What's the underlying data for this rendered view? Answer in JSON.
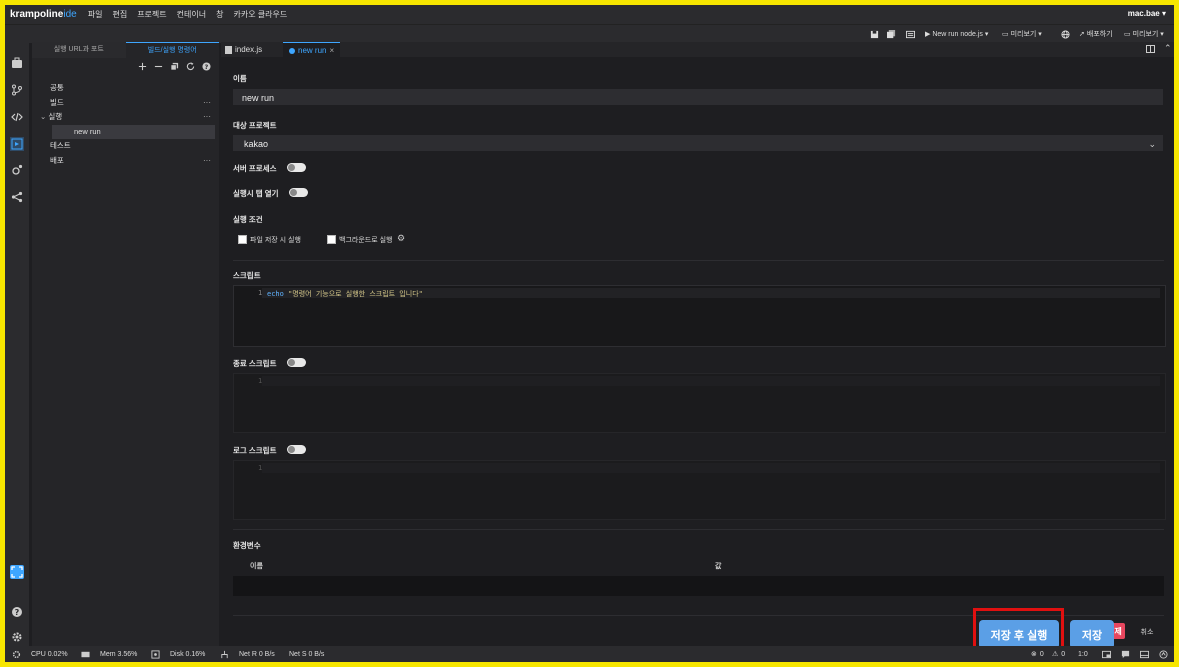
{
  "app": {
    "logo_main": "krampoline",
    "logo_sub": "ide",
    "user": "mac.bae ▾"
  },
  "menu": [
    "파일",
    "편집",
    "프로젝트",
    "컨테이너",
    "창",
    "카카오 클라우드"
  ],
  "toolbar": {
    "run_config": "New run node.js",
    "deploy": "배포하기",
    "preview": "미리보기",
    "preview2": "미리보기"
  },
  "sidebar": {
    "tabs": [
      "실행 URL과 포트",
      "빌드/실행 명령어"
    ],
    "tree": [
      {
        "label": "공통"
      },
      {
        "label": "빌드"
      },
      {
        "label": "실행"
      },
      {
        "label": "new run"
      },
      {
        "label": "테스트"
      },
      {
        "label": "배포"
      }
    ],
    "more": "···"
  },
  "editor": {
    "tabs": [
      {
        "label": "index.js"
      },
      {
        "label": "new run"
      }
    ],
    "name_label": "이름",
    "name_value": "new run",
    "project_label": "대상 프로젝트",
    "project_value": "kakao",
    "server_process_label": "서버 프로세스",
    "open_tab_label": "실행시 탭 열기",
    "run_condition_label": "실행 조건",
    "on_save_label": "파일 저장 시 실행",
    "background_label": "백그라운드로 실행",
    "script_label": "스크립트",
    "script_line_no": "1",
    "script_keyword": "echo",
    "script_string": "\"명령어 기능으로 실행한 스크립트 입니다\"",
    "end_script_label": "종료 스크립트",
    "end_line_no": "1",
    "log_script_label": "로그 스크립트",
    "log_line_no": "1",
    "env_label": "환경변수",
    "env_col_name": "이름",
    "env_col_value": "값"
  },
  "buttons": {
    "save_and_run": "저장 후 실행",
    "save": "저장",
    "delete_partial": "제",
    "cancel": "취소"
  },
  "status": {
    "cpu": "CPU 0.02%",
    "mem": "Mem 3.56%",
    "disk": "Disk 0.16%",
    "net_r": "Net R 0 B/s",
    "net_s": "Net S 0 B/s",
    "errors": "0",
    "warnings": "0",
    "position": "1:0"
  },
  "colors": {
    "accent": "#3ea6ff",
    "highlight_border": "#e01010",
    "frame": "#f7e600",
    "delete_red": "#e8475f"
  }
}
